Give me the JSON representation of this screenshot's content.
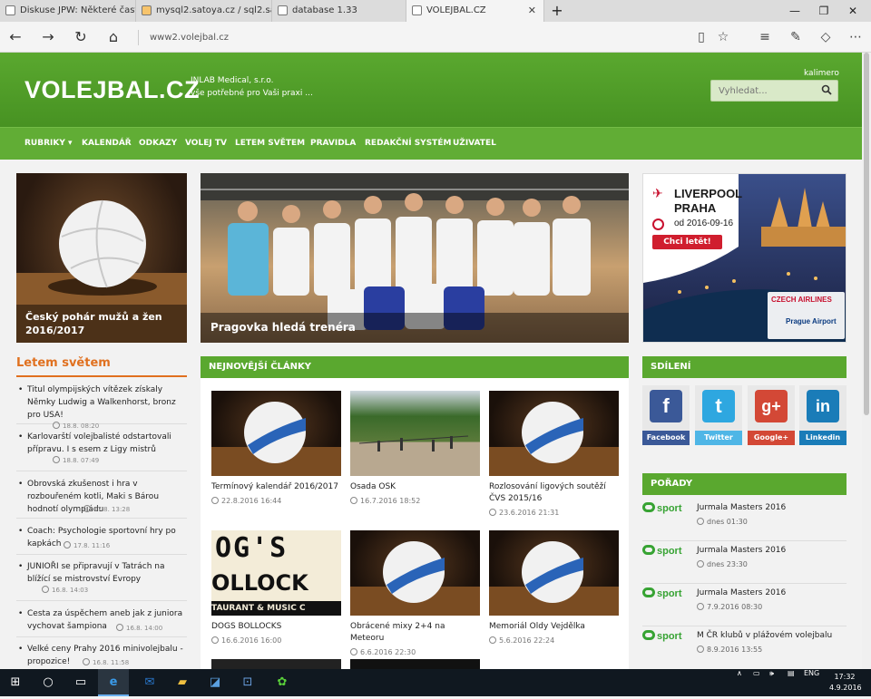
{
  "browser": {
    "tabs": [
      {
        "label": "Diskuse JPW: Některé časte"
      },
      {
        "label": "mysql2.satoya.cz / sql2.sato"
      },
      {
        "label": "database 1.33"
      },
      {
        "label": "VOLEJBAL.CZ"
      }
    ],
    "new_tab": "+",
    "url": "www2.volejbal.cz"
  },
  "site": {
    "logo": "VOLEJBAL.CZ",
    "sponsor_name": "INLAB Medical, s.r.o.",
    "sponsor_tagline": "vše potřebné pro Vaši praxi ...",
    "username": "kalimero",
    "search_placeholder": "Vyhledat..."
  },
  "menu": [
    {
      "label": "RUBRIKY ▾"
    },
    {
      "label": "KALENDÁŘ"
    },
    {
      "label": "ODKAZY"
    },
    {
      "label": "VOLEJ TV"
    },
    {
      "label": "LETEM SVĚTEM"
    },
    {
      "label": "PRAVIDLA"
    },
    {
      "label": "REDAKČNÍ SYSTÉM"
    },
    {
      "label": "UŽIVATEL"
    }
  ],
  "featured": [
    {
      "caption": "Český pohár mužů a žen 2016/2017"
    },
    {
      "caption": "Pragovka hledá trenéra"
    }
  ],
  "ad": {
    "line1": "LIVERPOOL",
    "line2": "PRAHA",
    "date": "od 2016-09-16",
    "cta": "Chci letět!",
    "airline": "CZECH AIRLINES",
    "airport": "Prague Airport"
  },
  "letem_svetem": {
    "title": "Letem světem",
    "items": [
      {
        "text": "Titul olympijských vítězek získaly Němky Ludwig a Walkenhorst, bronz pro USA!",
        "date": "18.8. 08:20"
      },
      {
        "text": "Karlovarští volejbalisté odstartovali přípravu. I s esem z Ligy mistrů",
        "date": "18.8. 07:49"
      },
      {
        "text": "Obrovská zkušenost i hra v rozbouřeném kotli, Maki s Bárou hodnotí olympiádu",
        "date": "17.8. 13:28"
      },
      {
        "text": "Coach: Psychologie sportovní hry po kapkách",
        "date": "17.8. 11:16"
      },
      {
        "text": "JUNIOŘI se připravují v Tatrách na blížící se mistrovství Evropy",
        "date": "16.8. 14:03"
      },
      {
        "text": "Cesta za úspěchem aneb jak z juniora vychovat šampiona",
        "date": "16.8. 14:00"
      },
      {
        "text": "Velké ceny Prahy 2016 minivolejbalu - propozice!",
        "date": "16.8. 11:58"
      }
    ]
  },
  "latest": {
    "title": "NEJNOVĚJŠÍ ČLÁNKY",
    "articles": [
      {
        "title": "Termínový kalendář 2016/2017",
        "date": "22.8.2016 16:44"
      },
      {
        "title": "Osada OSK",
        "date": "16.7.2016 18:52"
      },
      {
        "title": "Rozlosování ligových soutěží ČVS 2015/16",
        "date": "23.6.2016 21:31"
      },
      {
        "title": "DOGS BOLLOCKS",
        "date": "16.6.2016 16:00"
      },
      {
        "title": "Obrácené mixy 2+4 na Meteoru",
        "date": "6.6.2016 22:30"
      },
      {
        "title": "Memoriál Oldy Vejdělka",
        "date": "5.6.2016 22:24"
      }
    ],
    "dogs_sign": [
      "OG'S",
      "OLLOCK",
      "TAURANT & MUSIC C"
    ]
  },
  "sharing": {
    "title": "SDÍLENÍ",
    "buttons": [
      {
        "label": "Facebook",
        "glyph": "f",
        "color": "#3b5998"
      },
      {
        "label": "Twitter",
        "glyph": "t",
        "color": "#2ea7e0"
      },
      {
        "label": "Google+",
        "glyph": "g+",
        "color": "#d34836"
      },
      {
        "label": "Linkedin",
        "glyph": "in",
        "color": "#1a7cb8"
      }
    ]
  },
  "porady": {
    "title": "POŘADY",
    "channel": "sport",
    "items": [
      {
        "name": "Jurmala Masters 2016",
        "time": "dnes 01:30"
      },
      {
        "name": "Jurmala Masters 2016",
        "time": "dnes 23:30"
      },
      {
        "name": "Jurmala Masters 2016",
        "time": "7.9.2016 08:30"
      },
      {
        "name": "M ČR klubů v plážovém volejbalu",
        "time": "8.9.2016 13:55"
      }
    ]
  },
  "taskbar": {
    "lang": "ENG",
    "time": "17:32",
    "date": "4.9.2016"
  }
}
